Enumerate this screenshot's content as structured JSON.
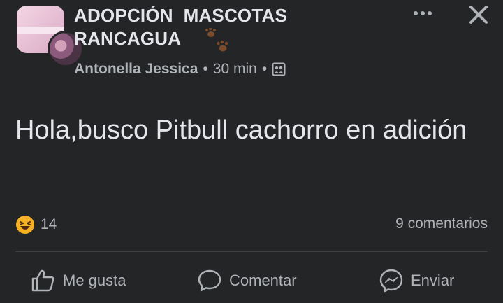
{
  "post": {
    "group_name": "ADOPCIÓN  MASCOTAS\nRANCAGUA",
    "author": "Antonella Jessica",
    "time": "30 min",
    "separator": "•",
    "text": "Hola,busco Pitbull cachorro en adición",
    "reaction_count": "14",
    "comments": "9 comentarios"
  },
  "actions": {
    "like_label": "Me gusta",
    "comment_label": "Comentar",
    "send_label": "Enviar"
  },
  "icons": {
    "more": "more-horizontal-icon",
    "close": "close-icon",
    "privacy": "group-members-icon",
    "reaction": "haha-reaction-icon",
    "like": "thumbs-up-icon",
    "comment": "speech-bubble-icon",
    "send": "messenger-icon"
  },
  "colors": {
    "background": "#242526",
    "primary_text": "#e4e6eb",
    "secondary_text": "#b0b3b8",
    "divider": "#3e4042",
    "reaction": "#f7b125",
    "paw": "#7a4a2a"
  }
}
